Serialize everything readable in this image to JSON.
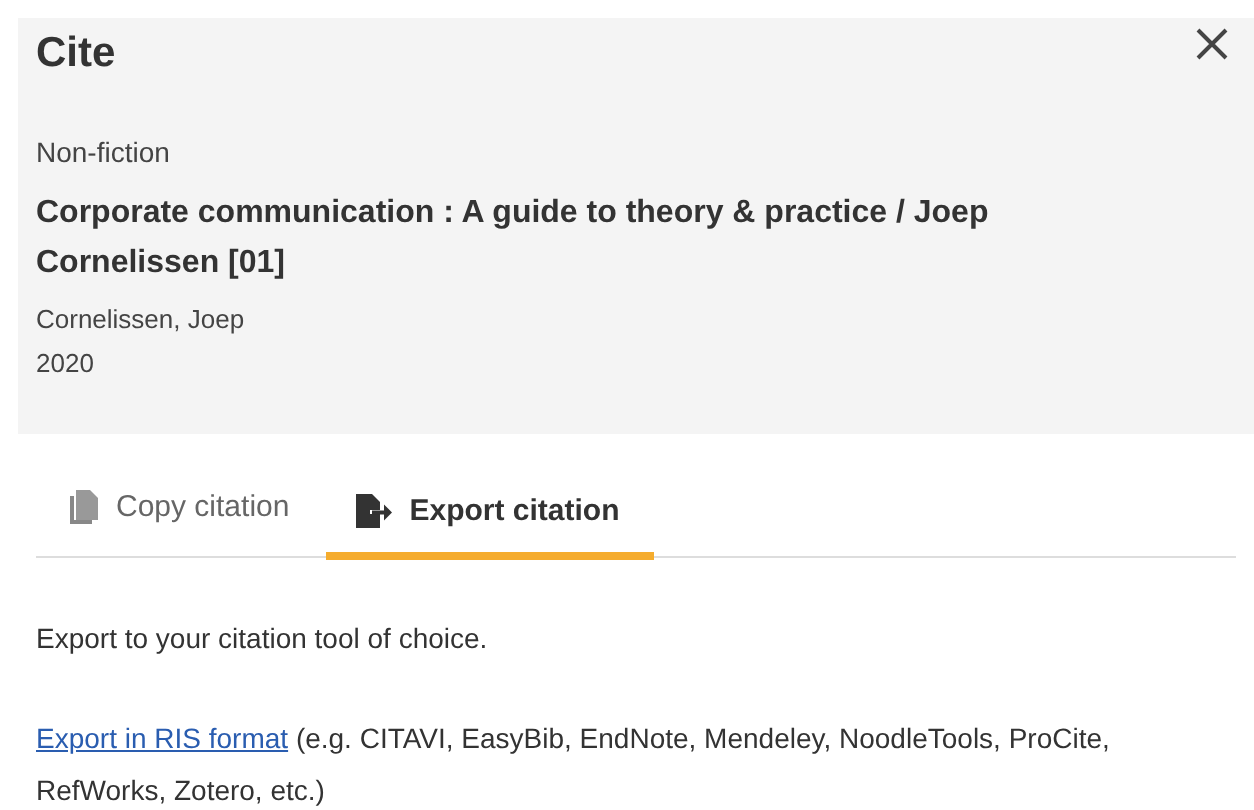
{
  "dialog": {
    "title": "Cite"
  },
  "record": {
    "type": "Non-fiction",
    "title": "Corporate communication : A guide to theory & practice / Joep Cornelissen [01]",
    "author": "Cornelissen, Joep",
    "year": "2020"
  },
  "tabs": [
    {
      "label": "Copy citation",
      "kind": "copy",
      "selected": false
    },
    {
      "label": "Export citation",
      "kind": "export",
      "selected": true
    }
  ],
  "export": {
    "intro": "Export to your citation tool of choice.",
    "link": "Export in RIS format",
    "note": "(e.g. CITAVI, EasyBib, EndNote, Mendeley, NoodleTools, ProCite, RefWorks, Zotero, etc.)"
  }
}
